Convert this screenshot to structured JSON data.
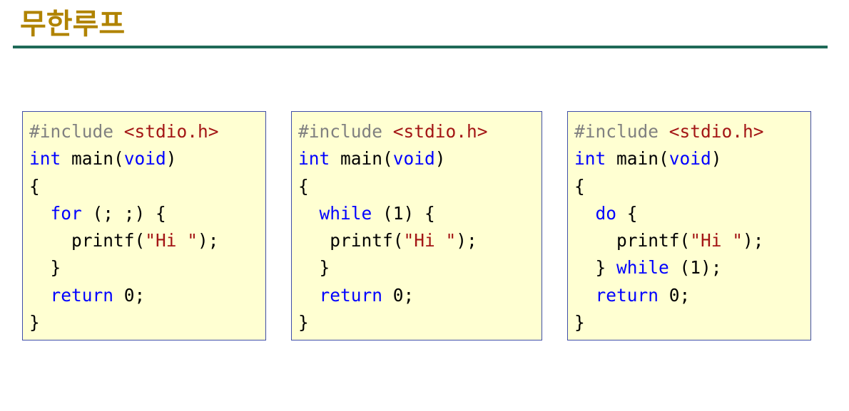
{
  "slide": {
    "title": "무한루프"
  },
  "code_blocks": [
    {
      "lines": [
        [
          {
            "t": "pre",
            "s": "#include "
          },
          {
            "t": "str",
            "s": "<stdio.h>"
          }
        ],
        [
          {
            "t": "kw",
            "s": "int"
          },
          {
            "t": "id",
            "s": " main("
          },
          {
            "t": "kw",
            "s": "void"
          },
          {
            "t": "id",
            "s": ")"
          }
        ],
        [
          {
            "t": "id",
            "s": "{"
          }
        ],
        [
          {
            "t": "id",
            "s": "  "
          },
          {
            "t": "kw",
            "s": "for"
          },
          {
            "t": "id",
            "s": " (; ;) {"
          }
        ],
        [
          {
            "t": "id",
            "s": "    printf("
          },
          {
            "t": "str",
            "s": "\"Hi \""
          },
          {
            "t": "id",
            "s": ");"
          }
        ],
        [
          {
            "t": "id",
            "s": "  }"
          }
        ],
        [
          {
            "t": "id",
            "s": "  "
          },
          {
            "t": "kw",
            "s": "return"
          },
          {
            "t": "id",
            "s": " 0;"
          }
        ],
        [
          {
            "t": "id",
            "s": "}"
          }
        ]
      ]
    },
    {
      "lines": [
        [
          {
            "t": "pre",
            "s": "#include "
          },
          {
            "t": "str",
            "s": "<stdio.h>"
          }
        ],
        [
          {
            "t": "kw",
            "s": "int"
          },
          {
            "t": "id",
            "s": " main("
          },
          {
            "t": "kw",
            "s": "void"
          },
          {
            "t": "id",
            "s": ")"
          }
        ],
        [
          {
            "t": "id",
            "s": "{"
          }
        ],
        [
          {
            "t": "id",
            "s": "  "
          },
          {
            "t": "kw",
            "s": "while"
          },
          {
            "t": "id",
            "s": " (1) {"
          }
        ],
        [
          {
            "t": "id",
            "s": "   printf("
          },
          {
            "t": "str",
            "s": "\"Hi \""
          },
          {
            "t": "id",
            "s": ");"
          }
        ],
        [
          {
            "t": "id",
            "s": "  }"
          }
        ],
        [
          {
            "t": "id",
            "s": "  "
          },
          {
            "t": "kw",
            "s": "return"
          },
          {
            "t": "id",
            "s": " 0;"
          }
        ],
        [
          {
            "t": "id",
            "s": "}"
          }
        ]
      ]
    },
    {
      "lines": [
        [
          {
            "t": "pre",
            "s": "#include "
          },
          {
            "t": "str",
            "s": "<stdio.h>"
          }
        ],
        [
          {
            "t": "kw",
            "s": "int"
          },
          {
            "t": "id",
            "s": " main("
          },
          {
            "t": "kw",
            "s": "void"
          },
          {
            "t": "id",
            "s": ")"
          }
        ],
        [
          {
            "t": "id",
            "s": "{"
          }
        ],
        [
          {
            "t": "id",
            "s": "  "
          },
          {
            "t": "kw",
            "s": "do"
          },
          {
            "t": "id",
            "s": " {"
          }
        ],
        [
          {
            "t": "id",
            "s": "    printf("
          },
          {
            "t": "str",
            "s": "\"Hi \""
          },
          {
            "t": "id",
            "s": ");"
          }
        ],
        [
          {
            "t": "id",
            "s": "  } "
          },
          {
            "t": "kw",
            "s": "while"
          },
          {
            "t": "id",
            "s": " (1);"
          }
        ],
        [
          {
            "t": "id",
            "s": "  "
          },
          {
            "t": "kw",
            "s": "return"
          },
          {
            "t": "id",
            "s": " 0;"
          }
        ],
        [
          {
            "t": "id",
            "s": "}"
          }
        ]
      ]
    }
  ],
  "colors": {
    "title": "#b08300",
    "rule": "#1f6a58",
    "code_background": "#ffffd2",
    "code_border": "#3f4ea8",
    "keyword": "#0000ff",
    "preprocessor": "#808080",
    "string": "#a31515"
  }
}
